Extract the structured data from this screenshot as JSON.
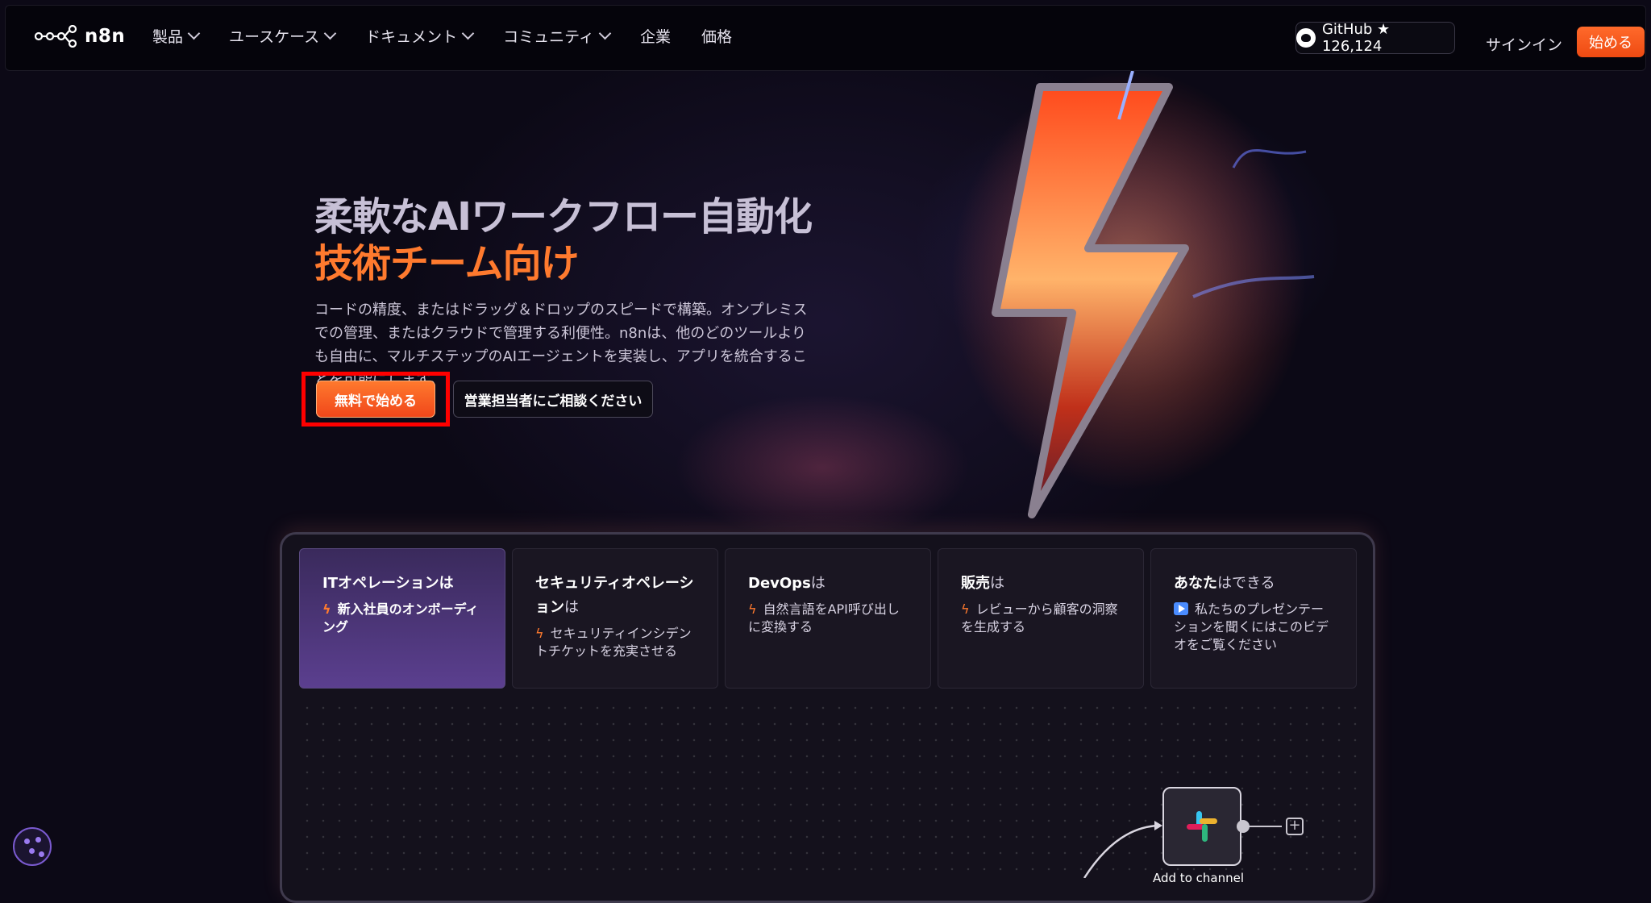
{
  "nav": {
    "logo_text": "n8n",
    "items": [
      {
        "label": "製品",
        "has_dropdown": true
      },
      {
        "label": "ユースケース",
        "has_dropdown": true
      },
      {
        "label": "ドキュメント",
        "has_dropdown": true
      },
      {
        "label": "コミュニティ",
        "has_dropdown": true
      },
      {
        "label": "企業",
        "has_dropdown": false
      },
      {
        "label": "価格",
        "has_dropdown": false
      }
    ],
    "github_label": "GitHub ★ 126,124",
    "signin_label": "サインイン",
    "start_label": "始める"
  },
  "hero": {
    "title_line1": "柔軟なAIワークフロー自動化",
    "title_line2": "技術チーム向け",
    "description": "コードの精度、またはドラッグ＆ドロップのスピードで構築。オンプレミスでの管理、またはクラウドで管理する利便性。n8nは、他のどのツールよりも自由に、マルチステップのAIエージェントを実装し、アプリを統合することを可能にします。",
    "cta_primary": "無料で始める",
    "cta_secondary": "営業担当者にご相談ください"
  },
  "tabs": [
    {
      "title_bold": "ITオペレーションは",
      "title_suffix": "",
      "subtitle": "新入社員のオンボーディング",
      "icon": "bolt-icon",
      "active": true
    },
    {
      "title_bold": "セキュリティオペレーション",
      "title_suffix": "は",
      "subtitle": "セキュリティインシデントチケットを充実させる",
      "icon": "bolt-icon",
      "active": false
    },
    {
      "title_bold": "DevOps",
      "title_suffix": "は",
      "subtitle": "自然言語をAPI呼び出しに変換する",
      "icon": "bolt-icon",
      "active": false
    },
    {
      "title_bold": "販売",
      "title_suffix": "は",
      "subtitle": "レビューから顧客の洞察を生成する",
      "icon": "bolt-icon",
      "active": false
    },
    {
      "title_bold": "あなた",
      "title_suffix": "はできる",
      "subtitle": "私たちのプレゼンテーションを聞くにはこのビデオをご覧ください",
      "icon": "play-icon",
      "active": false
    }
  ],
  "workflow": {
    "node_label": "Add to channel",
    "node_icon": "slack-icon"
  },
  "colors": {
    "accent": "#ff6a2b",
    "title_muted": "#c7c0d6",
    "title_orange": "#ff7a2e",
    "active_tab": "#5b3f8f",
    "highlight": "#ff0000"
  }
}
